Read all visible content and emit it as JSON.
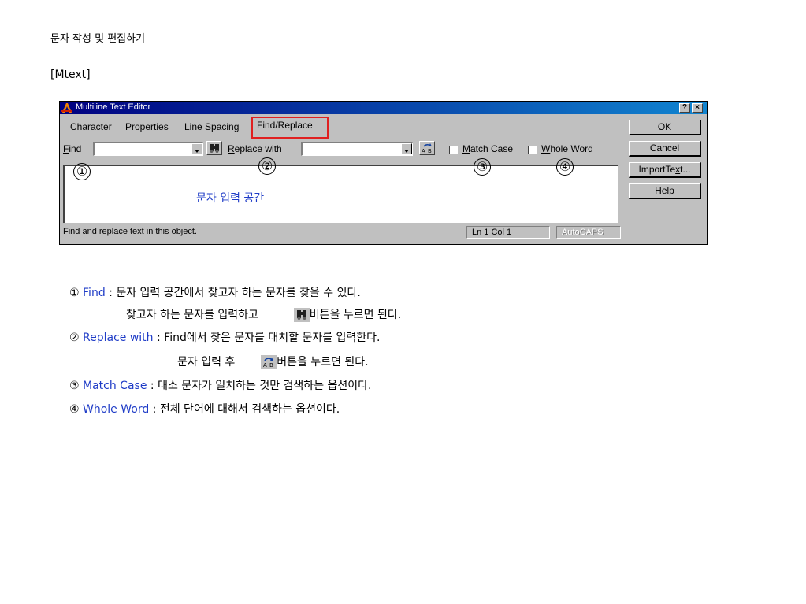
{
  "heading": "문자 작성 및 편집하기",
  "tag": "[Mtext]",
  "dialog": {
    "title": "Multiline Text Editor",
    "title_buttons": [
      "?",
      "×"
    ],
    "tabs": [
      "Character",
      "Properties",
      "Line Spacing",
      "Find/Replace"
    ],
    "active_tab": "Find/Replace",
    "buttons": {
      "ok": "OK",
      "cancel": "Cancel",
      "import": {
        "before": "ImportTe",
        "mnemonic": "x",
        "after": "t..."
      },
      "help": "Help"
    },
    "find": {
      "mnemonic": "F",
      "rest": "ind",
      "value": ""
    },
    "replace": {
      "mnemonic": "R",
      "rest": "eplace with",
      "value": ""
    },
    "match_case": {
      "mnemonic": "M",
      "rest": "atch Case",
      "checked": false
    },
    "whole_word": {
      "mnemonic": "W",
      "rest": "hole Word",
      "checked": false
    },
    "text_area": "문자 입력 공간",
    "status": "Find and replace text in this object.",
    "position": "Ln 1 Col 1",
    "autocaps": "AutoCAPS",
    "markers": [
      "①",
      "②",
      "③",
      "④"
    ],
    "icons": [
      "autocad-app-icon",
      "binoculars-find-icon",
      "find-replace-ab-icon"
    ]
  },
  "notes": [
    {
      "num": "①",
      "term": "Find",
      "text": " : 문자 입력 공간에서 찾고자 하는 문자를 찾을 수 있다."
    },
    {
      "before": "찾고자 하는 문자를 입력하고",
      "after": "버튼을 누르면 된다."
    },
    {
      "num": "②",
      "term": "Replace with",
      "text": " : Find에서 찾은 문자를 대치할 문자를 입력한다."
    },
    {
      "before": "문자 입력 후",
      "after": "버튼을 누르면 된다."
    },
    {
      "num": "③",
      "term": "Match Case",
      "text": " : 대소 문자가 일치하는 것만 검색하는 옵션이다."
    },
    {
      "num": "④",
      "term": "Whole Word",
      "text": " : 전체 단어에 대해서 검색하는 옵션이다."
    }
  ],
  "colors": {
    "title_bar": "#000080",
    "highlight": "#e02020",
    "term": "#1f3cc7",
    "dialog": "#c0c0c0"
  }
}
